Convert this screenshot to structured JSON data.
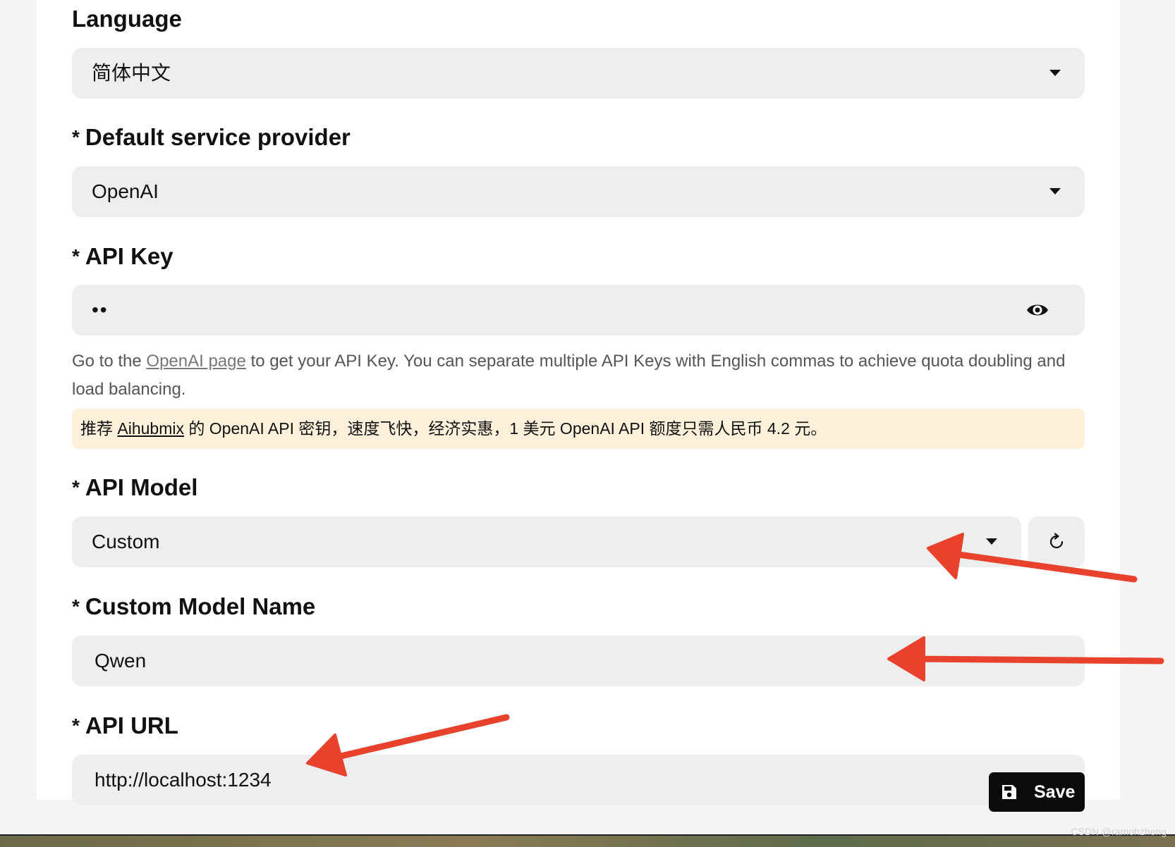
{
  "language": {
    "label": "Language",
    "value": "简体中文"
  },
  "provider": {
    "required_mark": "*",
    "label": "Default service provider",
    "value": "OpenAI"
  },
  "api_key": {
    "required_mark": "*",
    "label": "API Key",
    "value": "••"
  },
  "hint": {
    "before": "Go to the ",
    "link": "OpenAI page",
    "after": " to get your API Key. You can separate multiple API Keys with English commas to achieve quota doubling and load balancing."
  },
  "notice": {
    "before": "推荐 ",
    "link": "Aihubmix",
    "after": " 的 OpenAI API 密钥，速度飞快，经济实惠，1 美元 OpenAI API 额度只需人民币 4.2 元。",
    "background": "#fdf1dc"
  },
  "model": {
    "required_mark": "*",
    "label": "API Model",
    "value": "Custom"
  },
  "custom_model": {
    "required_mark": "*",
    "label": "Custom Model Name",
    "value": "Qwen"
  },
  "api_url": {
    "required_mark": "*",
    "label": "API URL",
    "value": "http://localhost:1234"
  },
  "save": {
    "label": "Save",
    "icon": "floppy-disk-icon"
  },
  "watermark": "CSDN @ramohzheng",
  "annotation_color": "#e8412c"
}
